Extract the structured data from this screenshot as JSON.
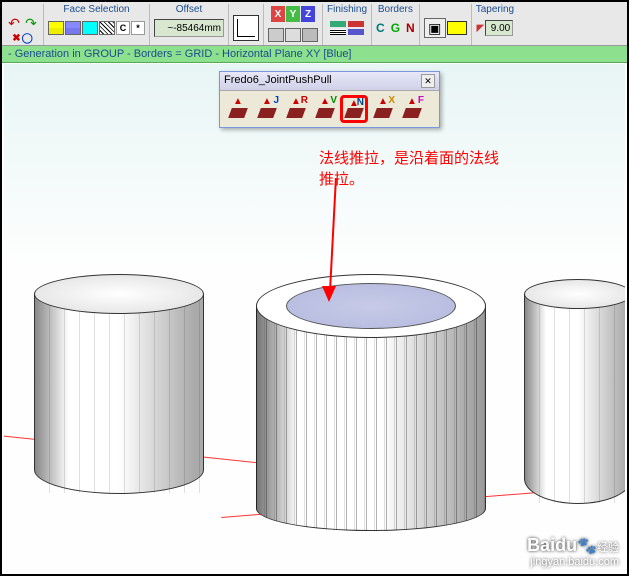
{
  "toolbar": {
    "face_selection": {
      "label": "Face Selection"
    },
    "offset": {
      "label": "Offset",
      "value": "~-85464mm"
    },
    "axes": {
      "x": "X",
      "y": "Y",
      "z": "Z"
    },
    "palette": {
      "c_label": "C",
      "star": "*"
    },
    "finishing": {
      "label": "Finishing"
    },
    "borders": {
      "label": "Borders",
      "c": "C",
      "g": "G",
      "n": "N"
    },
    "tapering": {
      "label": "Tapering",
      "value": "9.00"
    }
  },
  "status": "- Generation in GROUP - Borders = GRID - Horizontal Plane XY [Blue]",
  "float_toolbar": {
    "title": "Fredo6_JointPushPull",
    "tools": [
      {
        "letter": "",
        "cls": "lt-blank"
      },
      {
        "letter": "J",
        "cls": "lt-j"
      },
      {
        "letter": "R",
        "cls": "lt-r"
      },
      {
        "letter": "V",
        "cls": "lt-v"
      },
      {
        "letter": "N",
        "cls": "lt-n"
      },
      {
        "letter": "X",
        "cls": "lt-x"
      },
      {
        "letter": "F",
        "cls": "lt-f"
      }
    ]
  },
  "annotation": {
    "line1": "法线推拉，是沿着面的法线",
    "line2": "推拉。"
  },
  "watermark": {
    "brand": "Baidu",
    "suffix": "经验",
    "url": "jingyan.baidu.com"
  }
}
